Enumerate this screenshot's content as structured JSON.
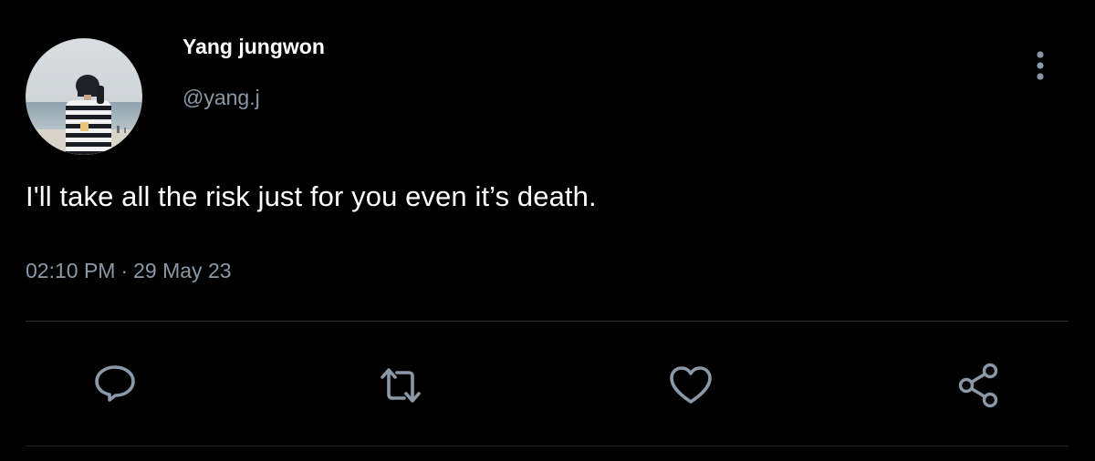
{
  "tweet": {
    "author": {
      "display_name": "Yang jungwon",
      "handle": "@yang.j",
      "avatar_icon": "profile-photo-beach"
    },
    "text": "I'll take all the risk just for you even it’s death.",
    "time": "02:10 PM",
    "separator": "·",
    "date": "29 May 23"
  },
  "actions": {
    "reply_icon": "reply-icon",
    "retweet_icon": "retweet-icon",
    "like_icon": "heart-icon",
    "share_icon": "share-icon",
    "more_icon": "more-vertical-icon"
  },
  "colors": {
    "background": "#000000",
    "primary_text": "#ffffff",
    "secondary_text": "#8b98a5",
    "divider": "#2f3336"
  }
}
